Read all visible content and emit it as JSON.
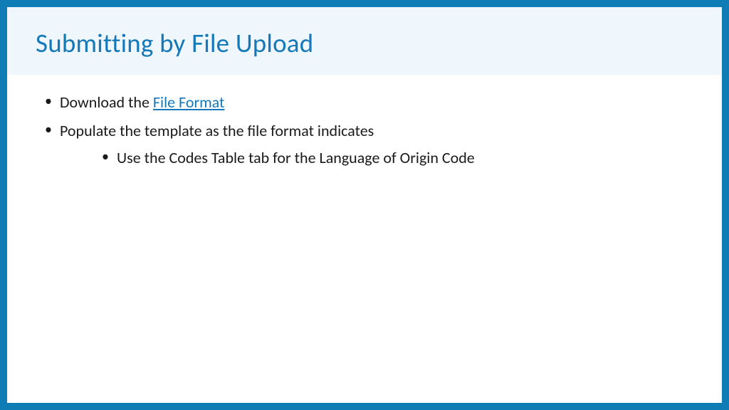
{
  "title": "Submitting by File Upload",
  "bullets": {
    "item1_prefix": "Download the ",
    "item1_link": "File Format",
    "item2": "Populate the template as the file format indicates",
    "item2_sub1": "Use the Codes Table tab for the Language of Origin Code"
  }
}
